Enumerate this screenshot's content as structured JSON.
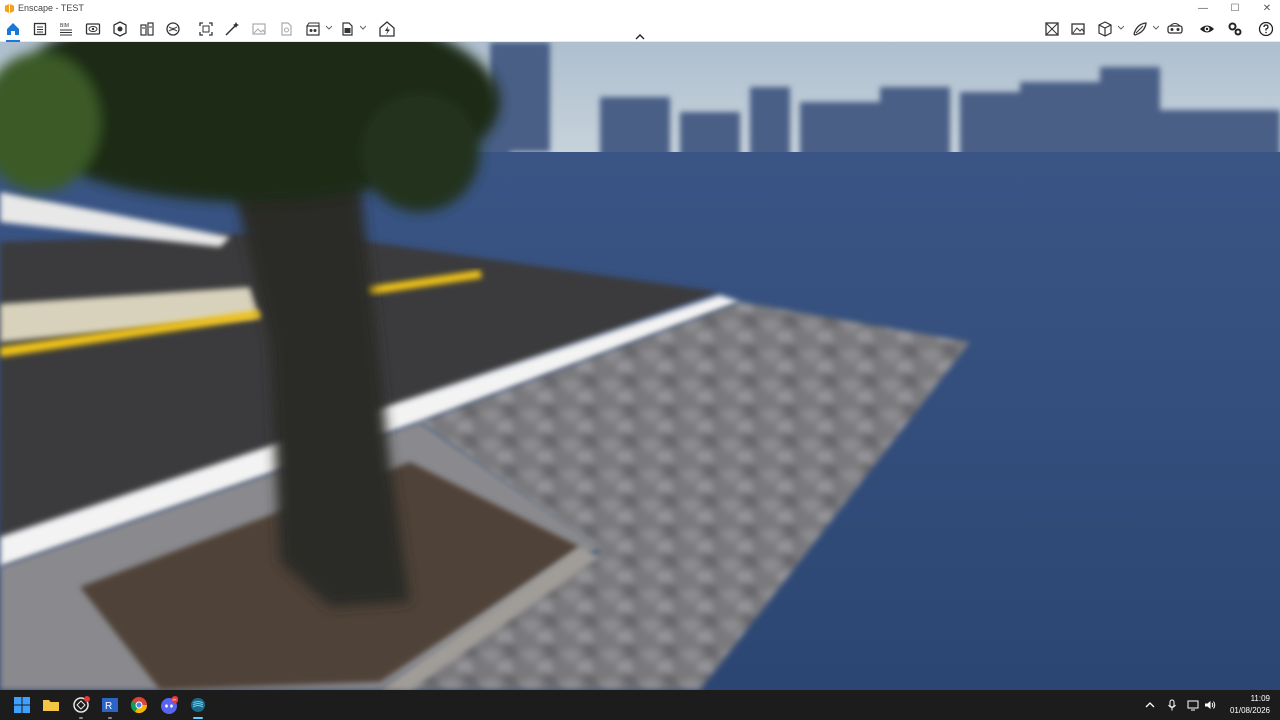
{
  "window": {
    "title": "Enscape - TEST",
    "minimize_glyph": "—",
    "maximize_glyph": "☐",
    "close_glyph": "✕"
  },
  "toolbar": {
    "left_icons": [
      "home-icon",
      "project-icon",
      "bim-list-icon",
      "view-icon",
      "material-icon",
      "asset-library-icon",
      "atmosphere-icon",
      "screenshot-icon",
      "batch-render-icon",
      "image-icon",
      "panorama-icon",
      "video-icon",
      "export-icon",
      "upload-icon"
    ],
    "right_icons": [
      "view-management-icon",
      "visual-settings-icon",
      "cube-icon",
      "light-icon",
      "vr-headset-icon",
      "eye-icon",
      "settings-icon",
      "help-icon"
    ],
    "accent_color": "#1b78d6",
    "bim_label": "BIM"
  },
  "taskbar": {
    "apps": [
      "windows-start-icon",
      "file-explorer-icon",
      "sketchup-icon",
      "revit-icon",
      "chrome-icon",
      "discord-icon",
      "enscape-icon"
    ],
    "discord_badge": "9+",
    "time": "11:09",
    "date": "01/08/2026"
  },
  "scene": {
    "description_icon": "3d-rendered-street-scene",
    "sky_color": "#b8c8d6",
    "ground_color": "#2f4a78",
    "road_color": "#3a3a3c",
    "line_color": "#f2c417"
  }
}
